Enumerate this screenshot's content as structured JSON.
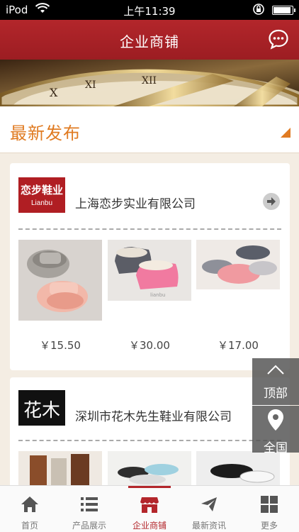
{
  "status_bar": {
    "carrier": "iPod",
    "time": "上午11:39",
    "battery_level": 0.95
  },
  "header": {
    "title": "企业商铺"
  },
  "section": {
    "title": "最新发布"
  },
  "stores": [
    {
      "logo_text": "恋步鞋业",
      "logo_subtext": "Lianbu",
      "name": "上海恋步实业有限公司",
      "prices": [
        "￥15.50",
        "￥30.00",
        "￥17.00"
      ]
    },
    {
      "logo_text": "花木",
      "name": "深圳市花木先生鞋业有限公司"
    }
  ],
  "float_buttons": {
    "top_label": "顶部",
    "region_label": "全国"
  },
  "tabs": [
    {
      "label": "首页",
      "icon": "home-icon"
    },
    {
      "label": "产品展示",
      "icon": "list-icon"
    },
    {
      "label": "企业商铺",
      "icon": "store-icon",
      "active": true
    },
    {
      "label": "最新资讯",
      "icon": "plane-icon"
    },
    {
      "label": "更多",
      "icon": "grid-icon"
    }
  ],
  "colors": {
    "brand": "#b3262b",
    "accent": "#e07b22",
    "background": "#f4ede3"
  }
}
